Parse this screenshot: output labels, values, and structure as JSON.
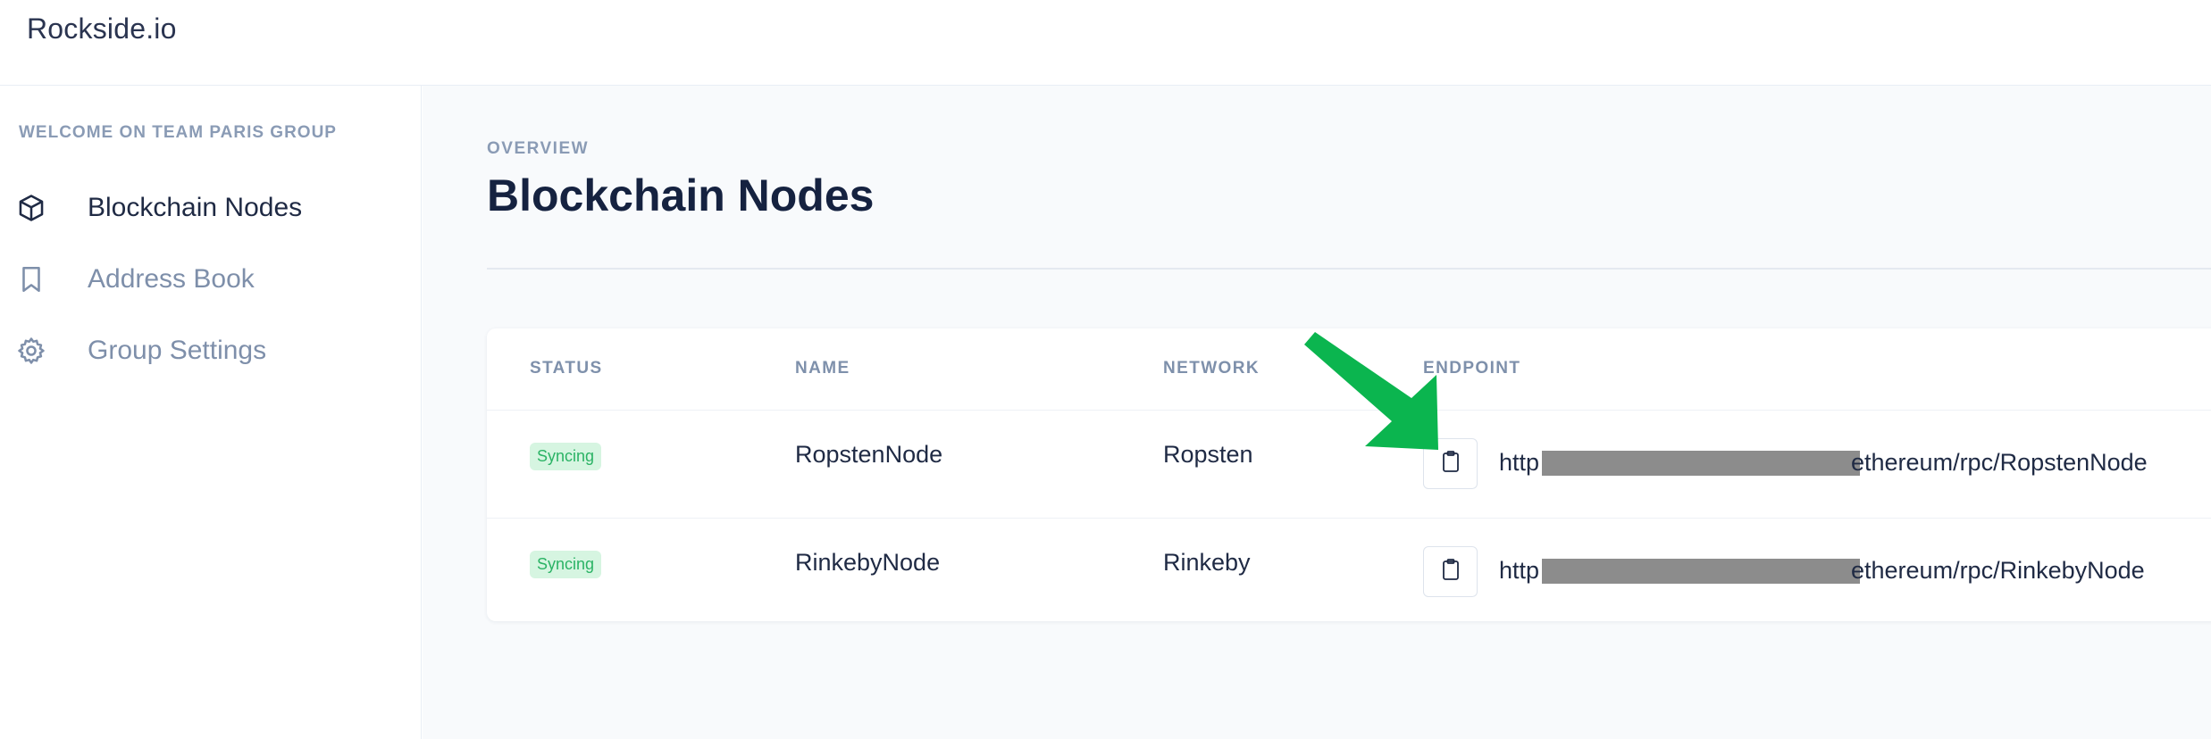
{
  "app": {
    "brand": "Rockside.io"
  },
  "sidebar": {
    "welcome": "WELCOME ON TEAM PARIS GROUP",
    "items": [
      {
        "label": "Blockchain Nodes",
        "icon": "cube-icon",
        "active": true
      },
      {
        "label": "Address Book",
        "icon": "bookmark-icon",
        "active": false
      },
      {
        "label": "Group Settings",
        "icon": "gear-icon",
        "active": false
      }
    ]
  },
  "main": {
    "overline": "OVERVIEW",
    "title": "Blockchain Nodes",
    "table": {
      "headers": {
        "status": "STATUS",
        "name": "NAME",
        "network": "NETWORK",
        "endpoint": "ENDPOINT"
      },
      "rows": [
        {
          "status": "Syncing",
          "name": "RopstenNode",
          "network": "Ropsten",
          "endpoint_prefix": "http",
          "endpoint_suffix": "ethereum/rpc/RopstenNode"
        },
        {
          "status": "Syncing",
          "name": "RinkebyNode",
          "network": "Rinkeby",
          "endpoint_prefix": "http",
          "endpoint_suffix": "ethereum/rpc/RinkebyNode"
        }
      ]
    }
  },
  "colors": {
    "accent_arrow": "#0bb54f",
    "badge_bg": "#d6f5e1",
    "badge_text": "#2bb365",
    "redaction": "#8c8c8c"
  }
}
